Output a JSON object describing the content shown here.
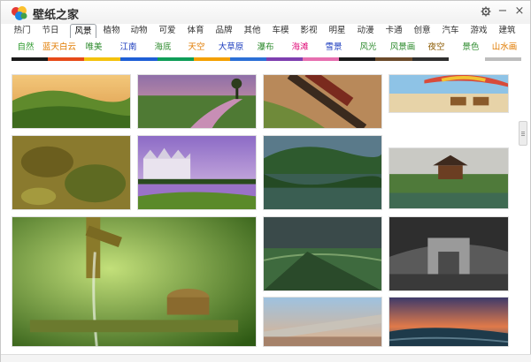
{
  "app": {
    "title": "壁纸之家"
  },
  "window_controls": {
    "settings_icon": "gear-icon",
    "minimize_label": "−",
    "close_label": "×"
  },
  "categories": [
    {
      "label": "热门"
    },
    {
      "label": "节日"
    },
    {
      "label": "风景",
      "active": true
    },
    {
      "label": "植物"
    },
    {
      "label": "动物"
    },
    {
      "label": "可爱"
    },
    {
      "label": "体育"
    },
    {
      "label": "品牌"
    },
    {
      "label": "其他"
    },
    {
      "label": "车模"
    },
    {
      "label": "影视"
    },
    {
      "label": "明星"
    },
    {
      "label": "动漫"
    },
    {
      "label": "卡通"
    },
    {
      "label": "创意"
    },
    {
      "label": "汽车"
    },
    {
      "label": "游戏"
    },
    {
      "label": "建筑"
    }
  ],
  "subcategories": [
    {
      "label": "自然",
      "color": "#2e9a2e"
    },
    {
      "label": "蓝天白云",
      "color": "#e07b00"
    },
    {
      "label": "唯美",
      "color": "#2e8b2e"
    },
    {
      "label": "江南",
      "color": "#1f3fbf"
    },
    {
      "label": "海底",
      "color": "#2e8b2e"
    },
    {
      "label": "天空",
      "color": "#e07b00"
    },
    {
      "label": "大草原",
      "color": "#1f3fbf"
    },
    {
      "label": "瀑布",
      "color": "#2e8b2e"
    },
    {
      "label": "海滩",
      "color": "#e0107b"
    },
    {
      "label": "雪景",
      "color": "#1f3fbf"
    },
    {
      "label": "风光",
      "color": "#2e8b2e"
    },
    {
      "label": "风景画",
      "color": "#2e8b2e"
    },
    {
      "label": "夜空",
      "color": "#8b5a00"
    },
    {
      "label": "景色",
      "color": "#2e8b2e"
    },
    {
      "label": "山水画",
      "color": "#e07b00"
    }
  ],
  "color_bar": [
    "#1a1a1a",
    "#e64a19",
    "#f4c20d",
    "#1e5fd6",
    "#0f9d58",
    "#f4a000",
    "#2b6fd6",
    "#7e3fb0",
    "#e66fb0",
    "#1a1a1a",
    "#6b4a2a",
    "#2f2f2f",
    "#ffffff",
    "#bdbdbd"
  ],
  "thumbnails": [
    {
      "name": "green-hills-sunset"
    },
    {
      "name": "purple-sky-river"
    },
    {
      "name": "train-in-autumn"
    },
    {
      "name": "beach-umbrella-chairs"
    },
    {
      "name": "underwater-green-rocks"
    },
    {
      "name": "castle-lake-purple"
    },
    {
      "name": "mountain-lake-reflection"
    },
    {
      "name": "chinese-pavilion"
    },
    {
      "name": "bamboo-water-fountain"
    },
    {
      "name": "green-grass-field"
    },
    {
      "name": "arc-de-triomphe"
    },
    {
      "name": "blurred-road-sunset"
    },
    {
      "name": "sunset-coast"
    }
  ]
}
